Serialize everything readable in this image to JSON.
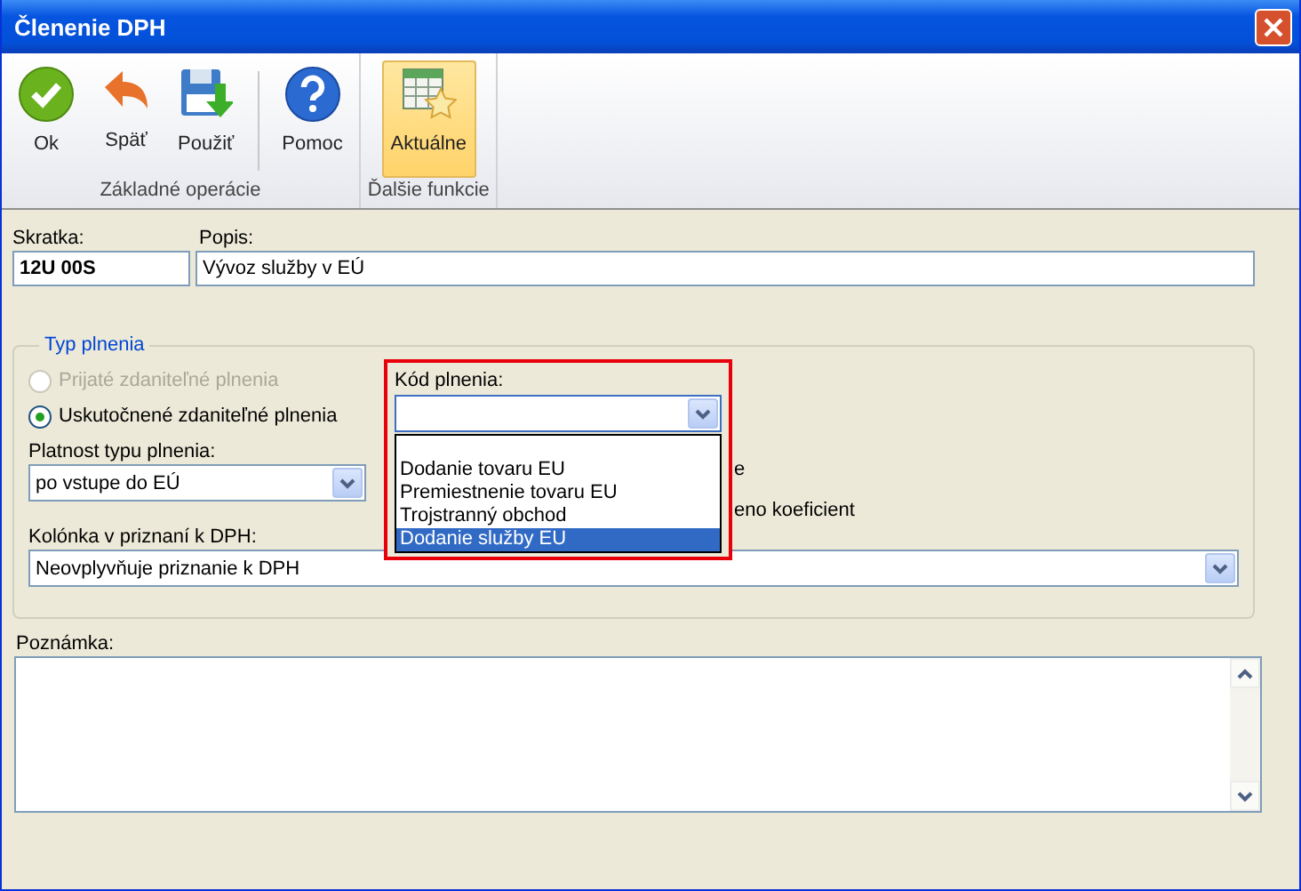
{
  "window": {
    "title": "Členenie DPH"
  },
  "ribbon": {
    "groups": [
      {
        "label": "Základné operácie",
        "buttons": [
          {
            "kind": "ok",
            "label": "Ok",
            "selected": false
          },
          {
            "kind": "back",
            "label": "Späť",
            "selected": false
          },
          {
            "kind": "save",
            "label": "Použiť",
            "selected": false
          },
          {
            "kind": "separator"
          },
          {
            "kind": "help",
            "label": "Pomoc",
            "selected": false
          }
        ]
      },
      {
        "label": "Ďalšie funkcie",
        "buttons": [
          {
            "kind": "table",
            "label": "Aktuálne",
            "selected": true
          }
        ]
      }
    ]
  },
  "skratka": {
    "label": "Skratka:",
    "value": "12U 00S"
  },
  "popis": {
    "label": "Popis:",
    "value": "Vývoz služby v EÚ"
  },
  "typ_plnenia": {
    "legend": "Typ plnenia",
    "radios": [
      {
        "label": "Prijaté zdaniteľné plnenia",
        "selected": false,
        "disabled": true
      },
      {
        "label": "Uskutočnené zdaniteľné plnenia",
        "selected": true,
        "disabled": false
      }
    ],
    "platnost": {
      "label": "Platnost typu plnenia:",
      "value": "po vstupe do EÚ"
    },
    "hidden_texts": [
      "e",
      "eno koeficient"
    ],
    "kod_plnenia": {
      "label": "Kód plnenia:",
      "expanded": true,
      "options": [
        {
          "label": "Dodanie tovaru EU",
          "selected": false
        },
        {
          "label": "Premiestnenie tovaru EU",
          "selected": false
        },
        {
          "label": "Trojstranný obchod",
          "selected": false
        },
        {
          "label": "Dodanie služby EU",
          "selected": true
        }
      ]
    },
    "kolonka": {
      "label": "Kolónka v priznaní k DPH:",
      "value": "Neovplyvňuje priznanie k DPH"
    }
  },
  "poznamka": {
    "label": "Poznámka:"
  }
}
